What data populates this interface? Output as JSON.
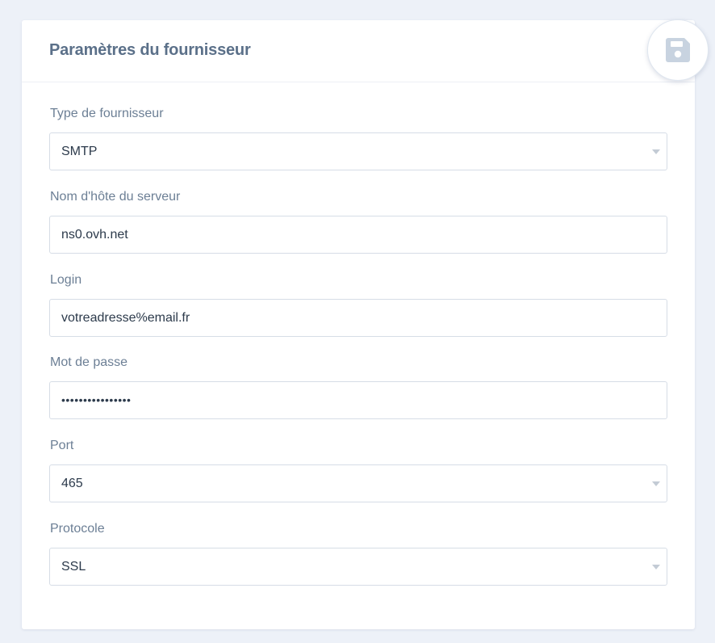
{
  "header": {
    "title": "Paramètres du fournisseur",
    "save_icon": "floppy-disk-icon"
  },
  "form": {
    "provider_type": {
      "label": "Type de fournisseur",
      "value": "SMTP"
    },
    "hostname": {
      "label": "Nom d'hôte du serveur",
      "value": "ns0.ovh.net"
    },
    "login": {
      "label": "Login",
      "value": "votreadresse%email.fr"
    },
    "password": {
      "label": "Mot de passe",
      "value": "••••••••••••••••"
    },
    "port": {
      "label": "Port",
      "value": "465"
    },
    "protocol": {
      "label": "Protocole",
      "value": "SSL"
    }
  },
  "colors": {
    "background": "#edf1f8",
    "title": "#5b7089",
    "label": "#6c7f95",
    "value": "#2c3a4b",
    "border": "#d6dde6",
    "save_icon": "#c8d3e0"
  }
}
